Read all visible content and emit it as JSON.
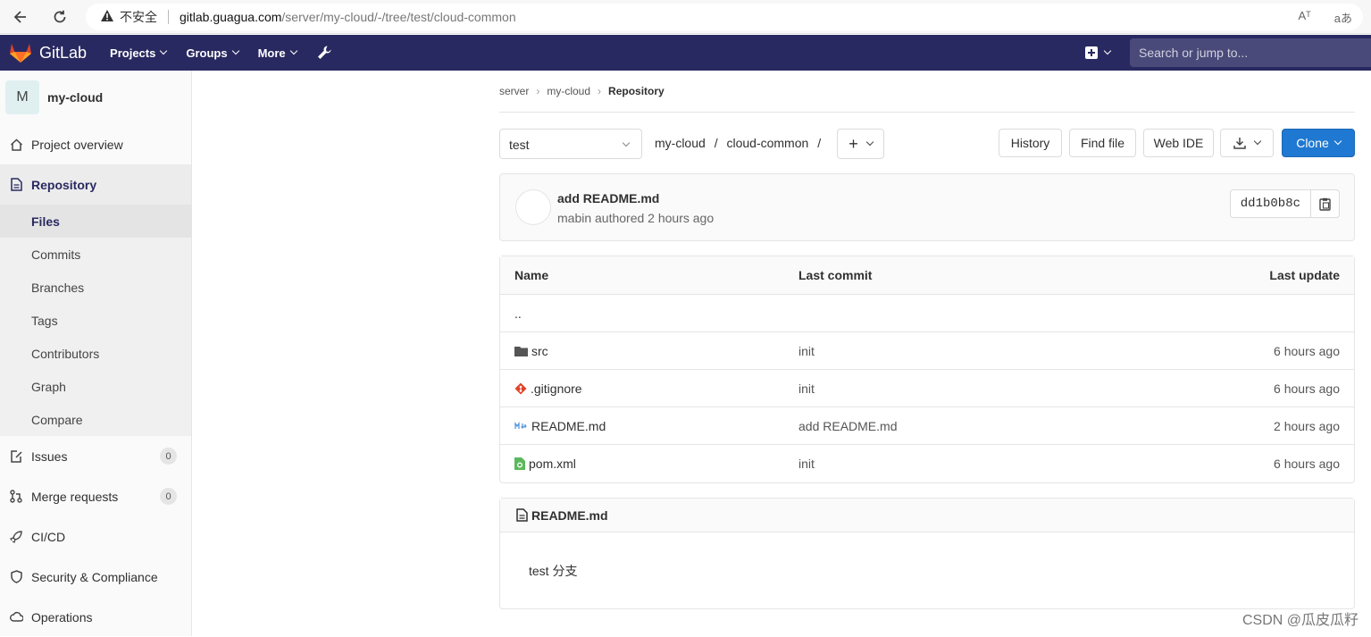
{
  "browser": {
    "insecure_label": "不安全",
    "url_host": "gitlab.guagua.com",
    "url_path": "/server/my-cloud/-/tree/test/cloud-common",
    "reader_icon": "Aᵀ",
    "translate_icon": "aあ"
  },
  "nav": {
    "logo_text": "GitLab",
    "projects": "Projects",
    "groups": "Groups",
    "more": "More",
    "search_placeholder": "Search or jump to..."
  },
  "sidebar": {
    "avatar_letter": "M",
    "project_name": "my-cloud",
    "project_overview": "Project overview",
    "repository": "Repository",
    "sub_items": [
      "Files",
      "Commits",
      "Branches",
      "Tags",
      "Contributors",
      "Graph",
      "Compare"
    ],
    "issues": "Issues",
    "issues_count": "0",
    "merge_requests": "Merge requests",
    "merge_requests_count": "0",
    "cicd": "CI/CD",
    "security": "Security & Compliance",
    "operations": "Operations"
  },
  "breadcrumb": {
    "group": "server",
    "project": "my-cloud",
    "current": "Repository"
  },
  "tree": {
    "branch": "test",
    "path_root": "my-cloud",
    "path_sep": "/",
    "path_dir": "cloud-common",
    "history": "History",
    "find_file": "Find file",
    "web_ide": "Web IDE",
    "clone": "Clone"
  },
  "commit": {
    "title": "add README.md",
    "meta": "mabin authored 2 hours ago",
    "sha": "dd1b0b8c"
  },
  "files": {
    "headers": {
      "name": "Name",
      "last_commit": "Last commit",
      "last_update": "Last update"
    },
    "parent": "..",
    "rows": [
      {
        "name": "src",
        "commit": "init",
        "update": "6 hours ago",
        "icon": "folder-icon"
      },
      {
        "name": ".gitignore",
        "commit": "init",
        "update": "6 hours ago",
        "icon": "git-icon"
      },
      {
        "name": "README.md",
        "commit": "add README.md",
        "update": "2 hours ago",
        "icon": "markdown-icon"
      },
      {
        "name": "pom.xml",
        "commit": "init",
        "update": "6 hours ago",
        "icon": "xml-icon"
      }
    ]
  },
  "readme": {
    "title": "README.md",
    "body": "test 分支"
  },
  "watermark": "CSDN @瓜皮瓜籽",
  "colors": {
    "nav_bg": "#292961",
    "primary": "#1f78d1",
    "sidebar_bg": "#fafafa"
  }
}
